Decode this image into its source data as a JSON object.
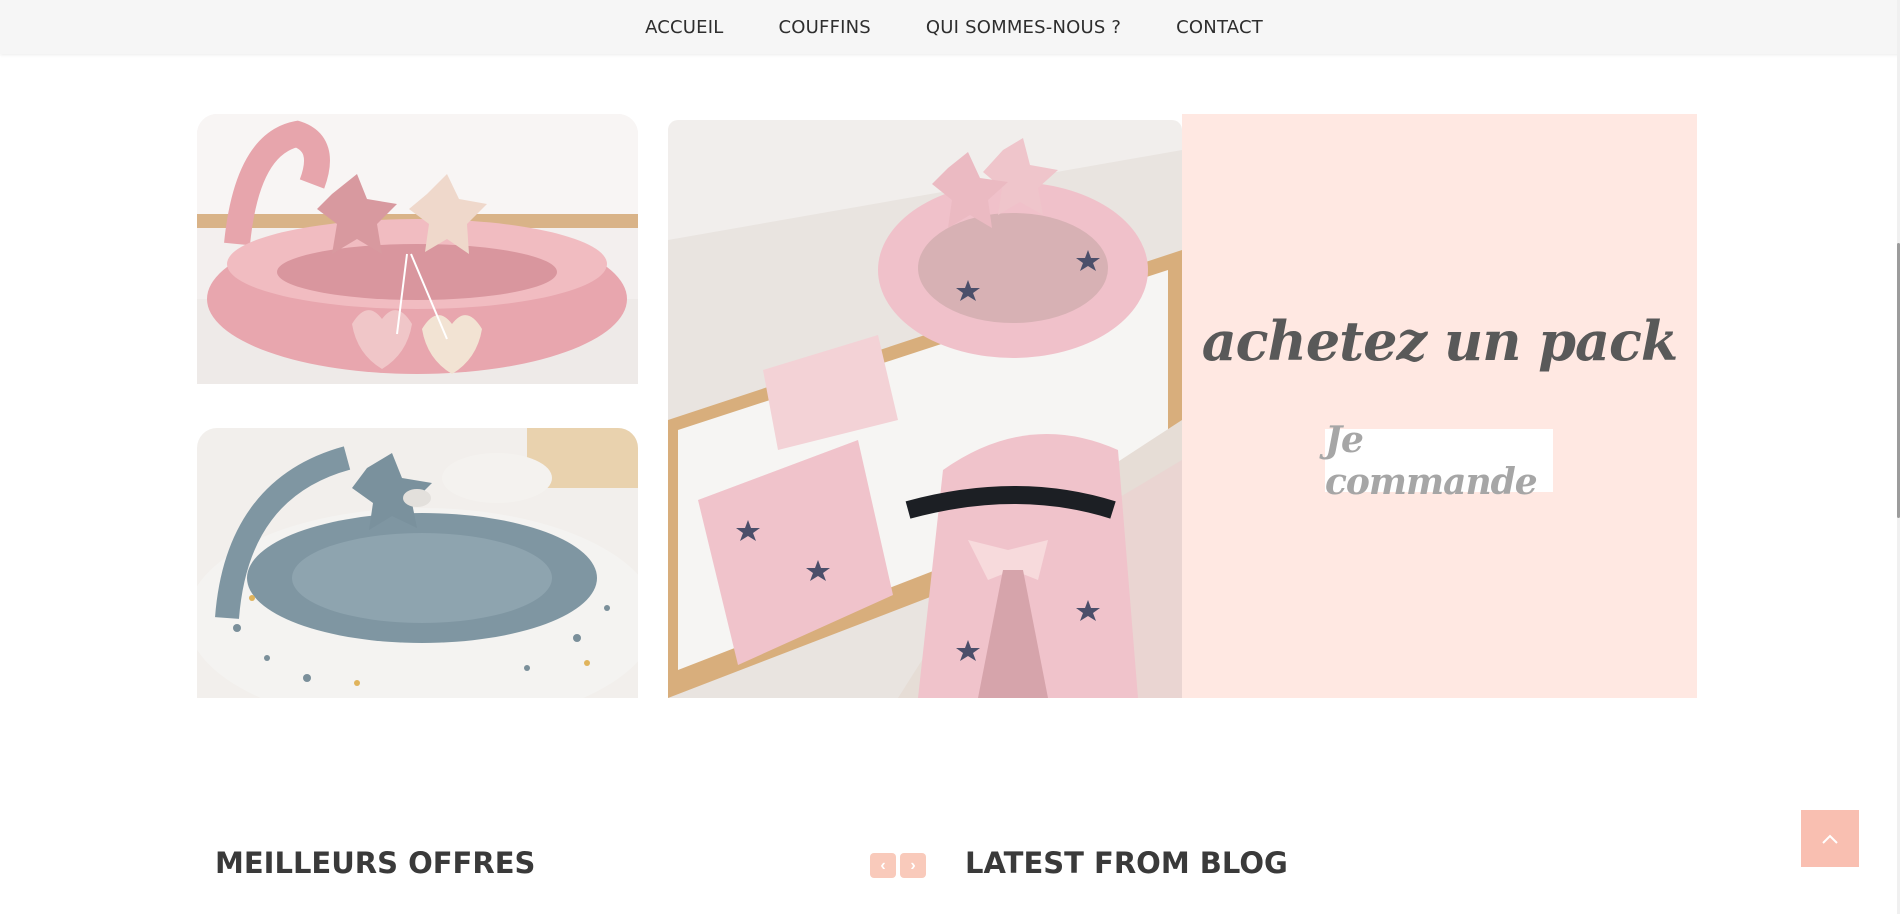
{
  "nav": {
    "items": [
      {
        "label": "ACCUEIL"
      },
      {
        "label": "COUFFINS"
      },
      {
        "label": "QUI SOMMES-NOUS ?"
      },
      {
        "label": "CONTACT"
      }
    ]
  },
  "promo": {
    "title": "achetez un pack",
    "button_label": "Je commande",
    "panel_color": "#ffe8e2",
    "images": [
      {
        "icon": "pink-baby-nest-photo"
      },
      {
        "icon": "blue-baby-nest-photo"
      },
      {
        "icon": "pink-star-pack-photo"
      }
    ]
  },
  "sections": {
    "offers_title": "MEILLEURS OFFRES",
    "blog_title": "LATEST FROM BLOG",
    "prev_icon": "chevron-left-icon",
    "next_icon": "chevron-right-icon",
    "prev_glyph": "‹",
    "next_glyph": "›"
  },
  "accent_color": "#f9bfb1",
  "back_to_top_icon": "chevron-up-icon"
}
